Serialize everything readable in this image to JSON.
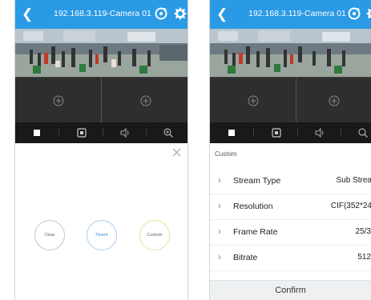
{
  "left": {
    "title": "192.168.3.119-Camera 01",
    "modes": [
      "Clear",
      "Fluent",
      "Custom"
    ]
  },
  "right": {
    "title": "192.168.3.119-Camera 01",
    "custom_label": "Custom",
    "rows": [
      {
        "label": "Stream Type",
        "value": "Sub Strea"
      },
      {
        "label": "Resolution",
        "value": "CIF(352*24"
      },
      {
        "label": "Frame Rate",
        "value": "25/3"
      },
      {
        "label": "Bitrate",
        "value": "512"
      }
    ],
    "confirm": "Confirm"
  },
  "colors": {
    "topbar": "#2a9ae6",
    "grid": "#2e2e2e",
    "control_bar": "#191919"
  }
}
